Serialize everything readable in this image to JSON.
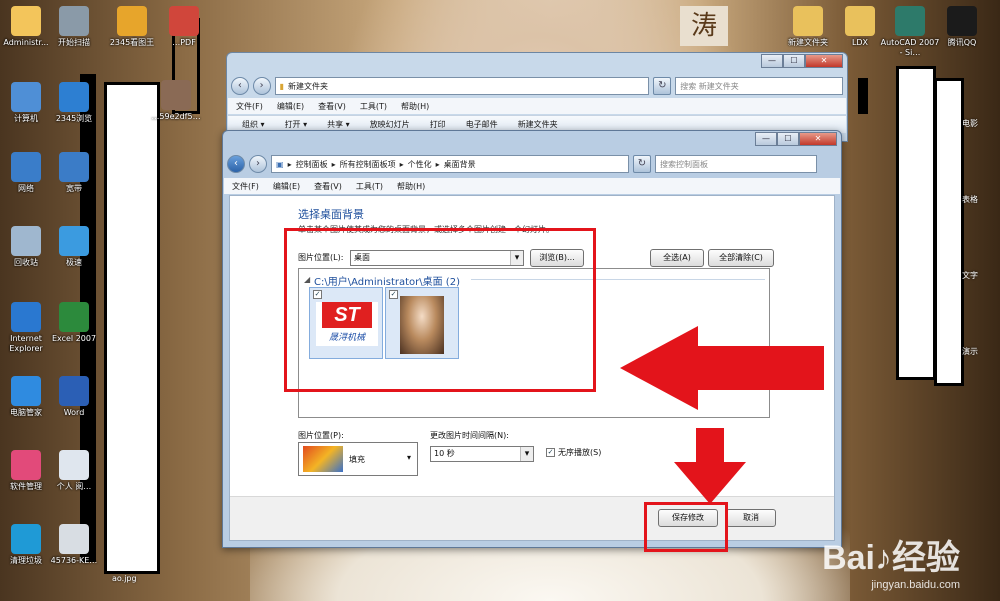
{
  "desktop": {
    "wallpaper_text": "涛",
    "icons_left": [
      {
        "label": "Administr...",
        "icon": "user-folder-icon",
        "color": "#f3c55b"
      },
      {
        "label": "计算机",
        "icon": "computer-icon",
        "color": "#4f8fd6"
      },
      {
        "label": "网络",
        "icon": "network-icon",
        "color": "#3a7dc9"
      },
      {
        "label": "回收站",
        "icon": "recycle-bin-icon",
        "color": "#9fb7cf"
      },
      {
        "label": "Internet Explorer",
        "icon": "ie-icon",
        "color": "#2a78d0"
      },
      {
        "label": "电脑管家",
        "icon": "shield-icon",
        "color": "#2f8be0"
      },
      {
        "label": "软件管理",
        "icon": "apps-icon",
        "color": "#e24a7a"
      },
      {
        "label": "清理垃圾",
        "icon": "cleaner-icon",
        "color": "#1f9ad6"
      }
    ],
    "icons_col2": [
      {
        "label": "开始扫描",
        "icon": "scanner-icon",
        "color": "#8a9aa8"
      },
      {
        "label": "2345浏览",
        "icon": "browser-icon",
        "color": "#2d7fd2"
      },
      {
        "label": "宽带",
        "icon": "broadband-icon",
        "color": "#3b7cc7"
      },
      {
        "label": "极速",
        "icon": "shortcut-icon",
        "color": "#3b9be0"
      },
      {
        "label": "Excel 2007",
        "icon": "excel-icon",
        "color": "#2c8a3c"
      },
      {
        "label": "Word",
        "icon": "word-icon",
        "color": "#2b5fb5"
      },
      {
        "label": "个人 阅…",
        "icon": "document-icon",
        "color": "#dfe6ee"
      },
      {
        "label": "45736-KE…",
        "icon": "pdf-file-icon",
        "color": "#d8dde3"
      }
    ],
    "icons_top": [
      {
        "label": "2345看图王",
        "icon": "image-viewer-icon",
        "color": "#e7a52b"
      },
      {
        "label": "…PDF",
        "icon": "pdf-icon",
        "color": "#d0463b"
      },
      {
        "label": "…59e2df5…",
        "icon": "photo-icon",
        "color": "#8a6a55"
      }
    ],
    "icons_right": [
      {
        "label": "新建文件夹",
        "icon": "folder-icon",
        "color": "#e9c15c"
      },
      {
        "label": "LDX",
        "icon": "folder-icon",
        "color": "#e9c15c"
      },
      {
        "label": "AutoCAD 2007 - Si…",
        "icon": "autocad-icon",
        "color": "#2d7a6a"
      },
      {
        "label": "腾讯QQ",
        "icon": "qq-icon",
        "color": "#1b1b1b"
      }
    ],
    "right_partial_labels": [
      "电影",
      "表格",
      "文字",
      "演示"
    ],
    "bottom_label": "ao.jpg",
    "watermark": {
      "main": "Bai♪经验",
      "sub": "jingyan.baidu.com"
    }
  },
  "back_window": {
    "address": "新建文件夹",
    "search_placeholder": "搜索 新建文件夹",
    "menu": [
      "文件(F)",
      "编辑(E)",
      "查看(V)",
      "工具(T)",
      "帮助(H)"
    ],
    "toolbar": [
      "组织 ▾",
      "打开 ▾",
      "共享 ▾",
      "放映幻灯片",
      "打印",
      "电子邮件",
      "新建文件夹"
    ]
  },
  "front_window": {
    "breadcrumb": [
      "控制面板",
      "所有控制面板项",
      "个性化",
      "桌面背景"
    ],
    "search_placeholder": "搜索控制面板",
    "menu": [
      "文件(F)",
      "编辑(E)",
      "查看(V)",
      "工具(T)",
      "帮助(H)"
    ],
    "heading": "选择桌面背景",
    "description": "单击某个图片使其成为您的桌面背景，或选择多个图片创建一个幻灯片。",
    "location_label": "图片位置(L):",
    "location_value": "桌面",
    "browse_button": "浏览(B)...",
    "select_all_button": "全选(A)",
    "clear_all_button": "全部清除(C)",
    "group_title": "C:\\用户\\Administrator\\桌面 (2)",
    "thumbnails": [
      {
        "name": "ST logo",
        "logo_text": "ST",
        "sub_text": "晟浔机械",
        "checked": "✓"
      },
      {
        "name": "portrait",
        "checked": "✓"
      }
    ],
    "position_label": "图片位置(P):",
    "position_value": "填充",
    "interval_label": "更改图片时间间隔(N):",
    "interval_value": "10 秒",
    "shuffle_label": "无序播放(S)",
    "shuffle_checked": "✓",
    "save_button": "保存修改",
    "cancel_button": "取消"
  },
  "colors": {
    "annotation_red": "#e3141b",
    "heading_blue": "#1e4f9c"
  }
}
